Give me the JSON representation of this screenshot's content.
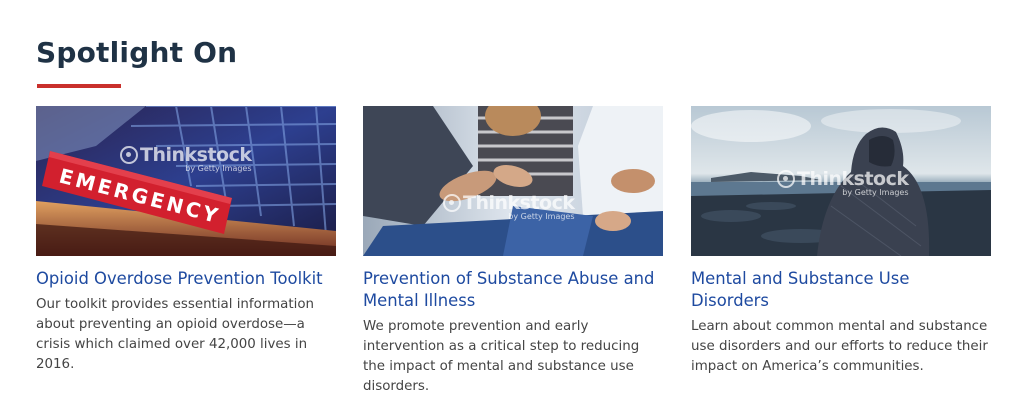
{
  "section": {
    "title": "Spotlight On",
    "accent_color": "#c9302c",
    "title_color": "#1f3245",
    "link_color": "#1e4aa0"
  },
  "cards": [
    {
      "image": {
        "subject": "emergency-sign-photo",
        "sign_text": "EMERGENCY",
        "watermark": "Thinkstock",
        "watermark_sub": "by Getty Images"
      },
      "title": "Opioid Overdose Prevention Toolkit",
      "description": "Our toolkit provides essential information about preventing an opioid overdose—a crisis which claimed over 42,000 lives in 2016."
    },
    {
      "image": {
        "subject": "support-group-hands-photo",
        "watermark": "Thinkstock",
        "watermark_sub": "by Getty Images"
      },
      "title": "Prevention of Substance Abuse and Mental Illness",
      "description": "We promote prevention and early intervention as a critical step to reducing the impact of mental and substance use disorders."
    },
    {
      "image": {
        "subject": "hooded-person-seaside-photo",
        "watermark": "Thinkstock",
        "watermark_sub": "by Getty Images"
      },
      "title": "Mental and Substance Use Disorders",
      "description": "Learn about common mental and substance use disorders and our efforts to reduce their impact on America’s communities."
    }
  ]
}
